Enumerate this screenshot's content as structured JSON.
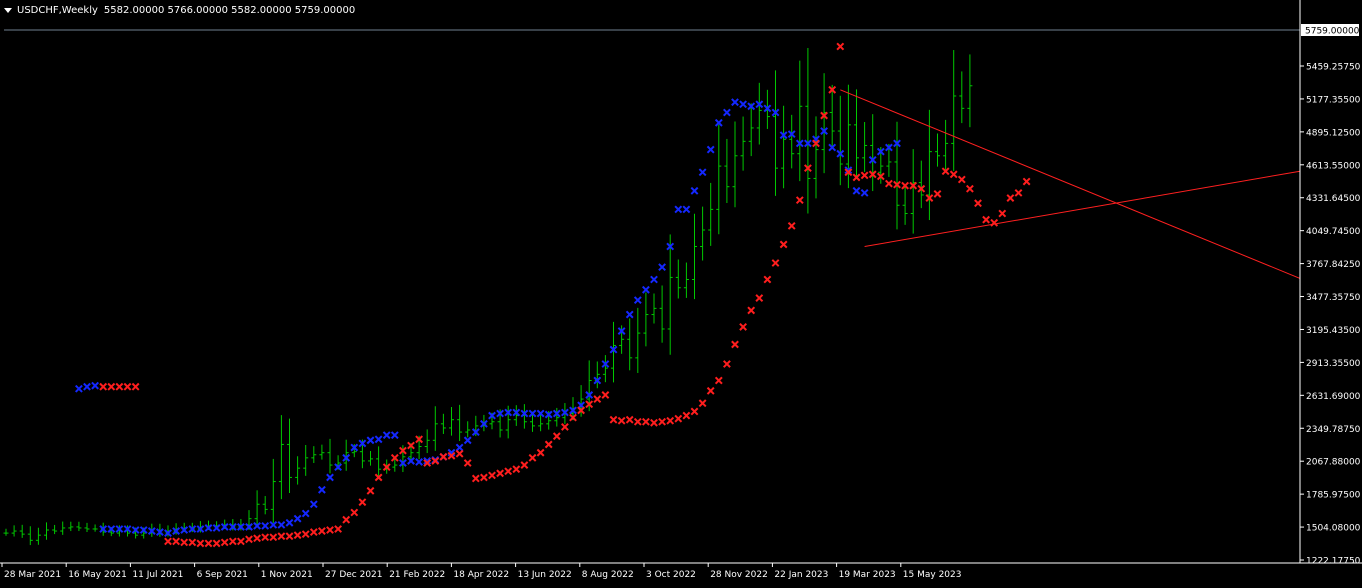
{
  "header": {
    "symbol_label": "USDCHF,Weekly",
    "ohlc_label": "5582.00000 5766.00000 5582.00000 5759.00000"
  },
  "colors": {
    "background": "#000000",
    "candle": "#00c800",
    "up_marker": "#1428ff",
    "down_marker": "#ff1e1e",
    "trendline": "#ff2020",
    "axis_text": "#ffffff",
    "price_line": "#708090"
  },
  "chart_data": {
    "type": "bar",
    "title": "USDCHF,Weekly",
    "current_price": "5759.00000",
    "y_ticks": [
      "5459.25750",
      "5177.35500",
      "4895.12500",
      "4613.55000",
      "4331.64500",
      "4049.74500",
      "3767.84250",
      "3477.35750",
      "3195.43500",
      "2913.35500",
      "2631.69000",
      "2349.78750",
      "2067.88000",
      "1785.97500",
      "1504.08000",
      "1222.17750"
    ],
    "x_ticks": [
      "28 Mar 2021",
      "16 May 2021",
      "11 Jul 2021",
      "6 Sep 2021",
      "1 Nov 2021",
      "27 Dec 2021",
      "21 Feb 2022",
      "18 Apr 2022",
      "13 Jun 2022",
      "8 Aug 2022",
      "3 Oct 2022",
      "28 Nov 2022",
      "22 Jan 2023",
      "19 Mar 2023",
      "15 May 2023"
    ],
    "ylim": [
      1130,
      6300
    ],
    "close": [
      1420,
      1440,
      1410,
      1350,
      1400,
      1450,
      1440,
      1470,
      1480,
      1470,
      1460,
      1460,
      1430,
      1420,
      1440,
      1420,
      1400,
      1420,
      1450,
      1420,
      1440,
      1460,
      1470,
      1460,
      1480,
      1490,
      1490,
      1500,
      1480,
      1500,
      1560,
      1700,
      1650,
      1920,
      2280,
      1960,
      2050,
      2150,
      2180,
      2200,
      2080,
      2100,
      2200,
      2210,
      2120,
      2140,
      2040,
      2060,
      2080,
      2160,
      2200,
      2260,
      2320,
      2480,
      2440,
      2520,
      2400,
      2420,
      2460,
      2480,
      2500,
      2420,
      2520,
      2560,
      2500,
      2460,
      2480,
      2510,
      2540,
      2580,
      2630,
      2720,
      2900,
      2960,
      3020,
      3240,
      3300,
      3120,
      3360,
      3540,
      3600,
      3400,
      3900,
      3800,
      3880,
      4200,
      4360,
      4560,
      4980,
      4780,
      5080,
      5220,
      5350,
      5520,
      5460,
      4960,
      5240,
      5100,
      5560,
      4860,
      5140,
      5500,
      5320,
      5000,
      5380,
      5060,
      5180,
      4920,
      4980,
      5020,
      4600,
      4520,
      4820,
      4700,
      5120,
      5080,
      5200,
      5660,
      5540,
      5759
    ],
    "markers_down": [
      [
        12,
        2840
      ],
      [
        13,
        2840
      ],
      [
        14,
        2840
      ],
      [
        15,
        2840
      ],
      [
        16,
        2840
      ],
      [
        20,
        1340
      ],
      [
        21,
        1340
      ],
      [
        22,
        1330
      ],
      [
        23,
        1330
      ],
      [
        24,
        1320
      ],
      [
        25,
        1320
      ],
      [
        26,
        1320
      ],
      [
        27,
        1330
      ],
      [
        28,
        1340
      ],
      [
        29,
        1340
      ],
      [
        30,
        1360
      ],
      [
        31,
        1370
      ],
      [
        32,
        1380
      ],
      [
        33,
        1380
      ],
      [
        34,
        1390
      ],
      [
        35,
        1390
      ],
      [
        36,
        1400
      ],
      [
        37,
        1410
      ],
      [
        38,
        1430
      ],
      [
        39,
        1440
      ],
      [
        40,
        1450
      ],
      [
        41,
        1460
      ],
      [
        42,
        1550
      ],
      [
        43,
        1620
      ],
      [
        44,
        1720
      ],
      [
        45,
        1830
      ],
      [
        46,
        1960
      ],
      [
        47,
        2060
      ],
      [
        48,
        2150
      ],
      [
        49,
        2220
      ],
      [
        50,
        2270
      ],
      [
        51,
        2330
      ],
      [
        52,
        2100
      ],
      [
        53,
        2120
      ],
      [
        54,
        2160
      ],
      [
        55,
        2170
      ],
      [
        56,
        2190
      ],
      [
        57,
        2100
      ],
      [
        58,
        1950
      ],
      [
        59,
        1960
      ],
      [
        60,
        1980
      ],
      [
        61,
        2000
      ],
      [
        62,
        2020
      ],
      [
        63,
        2040
      ],
      [
        64,
        2080
      ],
      [
        65,
        2150
      ],
      [
        66,
        2200
      ],
      [
        67,
        2280
      ],
      [
        68,
        2360
      ],
      [
        69,
        2450
      ],
      [
        70,
        2540
      ],
      [
        71,
        2610
      ],
      [
        72,
        2670
      ],
      [
        73,
        2720
      ],
      [
        74,
        2760
      ],
      [
        75,
        2520
      ],
      [
        76,
        2510
      ],
      [
        77,
        2520
      ],
      [
        78,
        2500
      ],
      [
        79,
        2500
      ],
      [
        80,
        2490
      ],
      [
        81,
        2500
      ],
      [
        82,
        2510
      ],
      [
        83,
        2530
      ],
      [
        84,
        2560
      ],
      [
        85,
        2600
      ],
      [
        86,
        2680
      ],
      [
        87,
        2800
      ],
      [
        88,
        2900
      ],
      [
        89,
        3060
      ],
      [
        90,
        3250
      ],
      [
        91,
        3420
      ],
      [
        92,
        3580
      ],
      [
        93,
        3700
      ],
      [
        94,
        3880
      ],
      [
        95,
        4040
      ],
      [
        96,
        4220
      ],
      [
        97,
        4400
      ],
      [
        98,
        4650
      ],
      [
        99,
        4960
      ],
      [
        100,
        5200
      ],
      [
        101,
        5470
      ],
      [
        102,
        5720
      ],
      [
        103,
        6140
      ],
      [
        104,
        4920
      ],
      [
        105,
        4870
      ],
      [
        106,
        4890
      ],
      [
        107,
        4900
      ],
      [
        108,
        4880
      ],
      [
        109,
        4810
      ],
      [
        110,
        4800
      ],
      [
        111,
        4790
      ],
      [
        112,
        4790
      ],
      [
        113,
        4760
      ],
      [
        114,
        4670
      ],
      [
        115,
        4710
      ],
      [
        116,
        4930
      ],
      [
        117,
        4900
      ],
      [
        118,
        4850
      ],
      [
        119,
        4760
      ],
      [
        120,
        4620
      ],
      [
        121,
        4460
      ],
      [
        122,
        4430
      ],
      [
        123,
        4520
      ],
      [
        124,
        4670
      ],
      [
        125,
        4720
      ],
      [
        126,
        4830
      ]
    ],
    "markers_up": [
      [
        9,
        2820
      ],
      [
        10,
        2840
      ],
      [
        11,
        2850
      ],
      [
        12,
        1460
      ],
      [
        13,
        1460
      ],
      [
        14,
        1460
      ],
      [
        15,
        1460
      ],
      [
        16,
        1450
      ],
      [
        17,
        1450
      ],
      [
        18,
        1440
      ],
      [
        19,
        1430
      ],
      [
        20,
        1420
      ],
      [
        21,
        1440
      ],
      [
        22,
        1450
      ],
      [
        23,
        1460
      ],
      [
        24,
        1460
      ],
      [
        25,
        1470
      ],
      [
        26,
        1470
      ],
      [
        27,
        1480
      ],
      [
        28,
        1480
      ],
      [
        29,
        1480
      ],
      [
        30,
        1480
      ],
      [
        31,
        1490
      ],
      [
        32,
        1490
      ],
      [
        33,
        1500
      ],
      [
        34,
        1500
      ],
      [
        35,
        1520
      ],
      [
        36,
        1560
      ],
      [
        37,
        1610
      ],
      [
        38,
        1700
      ],
      [
        39,
        1840
      ],
      [
        40,
        1960
      ],
      [
        41,
        2060
      ],
      [
        42,
        2150
      ],
      [
        43,
        2250
      ],
      [
        44,
        2290
      ],
      [
        45,
        2320
      ],
      [
        46,
        2330
      ],
      [
        47,
        2370
      ],
      [
        48,
        2370
      ],
      [
        49,
        2100
      ],
      [
        50,
        2120
      ],
      [
        51,
        2110
      ],
      [
        52,
        2120
      ],
      [
        53,
        2130
      ],
      [
        54,
        2160
      ],
      [
        55,
        2200
      ],
      [
        56,
        2250
      ],
      [
        57,
        2320
      ],
      [
        58,
        2400
      ],
      [
        59,
        2480
      ],
      [
        60,
        2560
      ],
      [
        61,
        2580
      ],
      [
        62,
        2590
      ],
      [
        63,
        2590
      ],
      [
        64,
        2580
      ],
      [
        65,
        2580
      ],
      [
        66,
        2580
      ],
      [
        67,
        2570
      ],
      [
        68,
        2580
      ],
      [
        69,
        2590
      ],
      [
        70,
        2610
      ],
      [
        71,
        2660
      ],
      [
        72,
        2760
      ],
      [
        73,
        2900
      ],
      [
        74,
        3060
      ],
      [
        75,
        3200
      ],
      [
        76,
        3380
      ],
      [
        77,
        3540
      ],
      [
        78,
        3680
      ],
      [
        79,
        3780
      ],
      [
        80,
        3880
      ],
      [
        81,
        4000
      ],
      [
        82,
        4200
      ],
      [
        83,
        4560
      ],
      [
        84,
        4560
      ],
      [
        85,
        4740
      ],
      [
        86,
        4920
      ],
      [
        87,
        5140
      ],
      [
        88,
        5400
      ],
      [
        89,
        5500
      ],
      [
        90,
        5600
      ],
      [
        91,
        5580
      ],
      [
        92,
        5560
      ],
      [
        93,
        5580
      ],
      [
        94,
        5540
      ],
      [
        95,
        5500
      ],
      [
        96,
        5280
      ],
      [
        97,
        5290
      ],
      [
        98,
        5200
      ],
      [
        99,
        5200
      ],
      [
        100,
        5240
      ],
      [
        101,
        5320
      ],
      [
        102,
        5160
      ],
      [
        103,
        5100
      ],
      [
        104,
        4940
      ],
      [
        105,
        4740
      ],
      [
        106,
        4720
      ],
      [
        107,
        5040
      ],
      [
        108,
        5120
      ],
      [
        109,
        5160
      ],
      [
        110,
        5200
      ]
    ],
    "trendlines": [
      {
        "from": [
          103,
          5720
        ],
        "to": [
          170,
          3890
        ]
      },
      {
        "from": [
          106,
          4200
        ],
        "to": [
          170,
          4930
        ]
      }
    ]
  }
}
